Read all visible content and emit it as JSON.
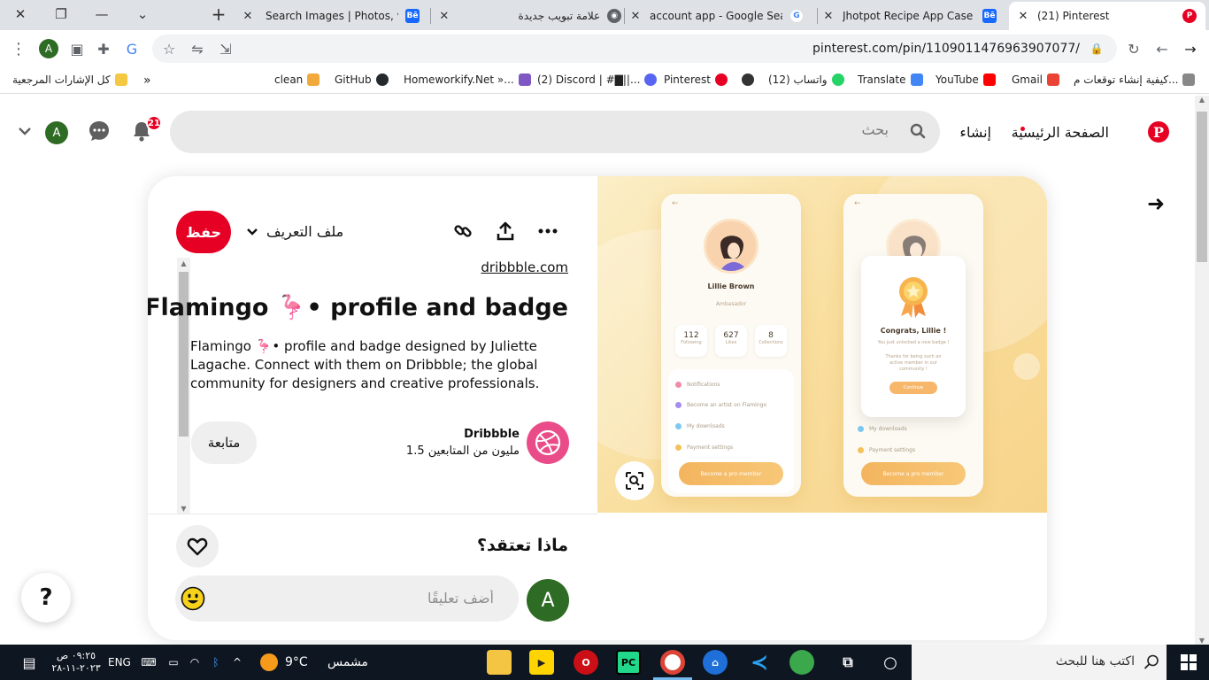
{
  "browser": {
    "tabs": [
      {
        "title": "Search Images | Photos, vide",
        "favicon": "behance"
      },
      {
        "title": "علامة تبويب جديدة",
        "favicon": "chrome"
      },
      {
        "title": "account app - Google Search",
        "favicon": "google"
      },
      {
        "title": "Jhotpot Recipe App Case Stu",
        "favicon": "behance"
      },
      {
        "title": "(21) Pinterest",
        "favicon": "pinterest",
        "active": true
      }
    ],
    "url": "pinterest.com/pin/1109011476963907077/",
    "profile_initial": "A",
    "bookmarks": [
      {
        "label": "كيفية إنشاء توقعات م..."
      },
      {
        "label": "Gmail"
      },
      {
        "label": "YouTube"
      },
      {
        "label": "Translate"
      },
      {
        "label": "(12) واتساب"
      },
      {
        "label": ""
      },
      {
        "label": "Pinterest"
      },
      {
        "label": "(2) Discord | #▇||..."
      },
      {
        "label": "Homeworkify.Net »..."
      },
      {
        "label": "GitHub"
      },
      {
        "label": "clean"
      }
    ],
    "all_bookmarks": "كل الإشارات المرجعية",
    "more": "»"
  },
  "pinterest": {
    "nav_home": "الصفحة الرئيسية",
    "nav_create": "إنشاء",
    "search_placeholder": "بحث",
    "notifications_count": "21",
    "user_initial": "A"
  },
  "pin": {
    "save_label": "حفظ",
    "profile_label": "ملف التعريف",
    "source": "dribbble.com",
    "title": "Flamingo 🦩• profile and badge",
    "description": "Flamingo 🦩• profile and badge designed by Juliette Lagache. Connect with them on Dribbble; the global community for designers and creative professionals.",
    "creator_name": "Dribbble",
    "creator_followers": "1.5 مليون من المتابعين",
    "follow_label": "متابعة",
    "comments_heading": "ماذا تعتقد؟",
    "comment_placeholder": "أضف تعليقًا",
    "user_initial": "A",
    "help": "?",
    "image": {
      "profile_name": "Lillie Brown",
      "profile_role": "Ambasador",
      "stats": [
        {
          "value": "112",
          "label": "Following"
        },
        {
          "value": "627",
          "label": "Likes"
        },
        {
          "value": "8",
          "label": "Collections"
        }
      ],
      "menu": [
        "Notifications",
        "Become an artist on Flamingo",
        "My downloads",
        "Payment settings"
      ],
      "pro_button": "Become a pro member",
      "congrats": "Congrats, Lillie !",
      "unlocked": "You just unlocked a new badge !",
      "thanks": "Thanks for being such an active member in our community !",
      "continue": "Continue"
    }
  },
  "taskbar": {
    "search_placeholder": "اكتب هنا للبحث",
    "weather_label": "مشمس",
    "temperature": "9°C",
    "language": "ENG",
    "time": "٠٩:٢٥ ص",
    "date": "٢٠٢٣-١١-٢٨"
  },
  "colors": {
    "pinterest_red": "#e60023",
    "dribbble_pink": "#ea4c89",
    "user_avatar": "#2e6b24"
  }
}
